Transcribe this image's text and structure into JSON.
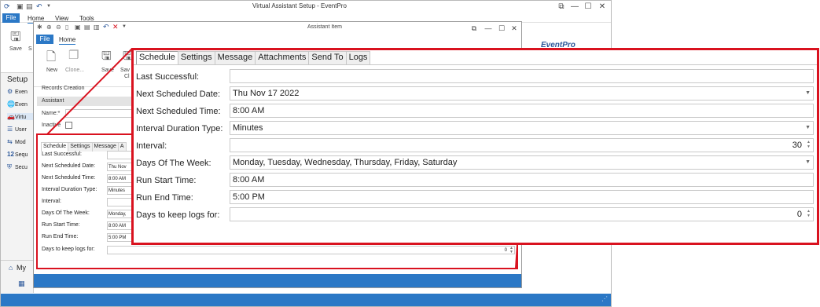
{
  "main_window": {
    "title": "Virtual Assistant Setup - EventPro",
    "menu": {
      "file": "File",
      "home": "Home",
      "view": "View",
      "tools": "Tools"
    },
    "ribbon": {
      "save_label": "Save",
      "save2_label": "S"
    },
    "sidebar": {
      "heading": "Setup",
      "items": [
        {
          "label": "Even",
          "icon": "gear-icon"
        },
        {
          "label": "Even",
          "icon": "globe-icon"
        },
        {
          "label": "Virtu",
          "icon": "car-icon"
        },
        {
          "label": "User",
          "icon": "user-icon"
        },
        {
          "label": "Mod",
          "icon": "module-icon"
        },
        {
          "label": "Sequ",
          "icon": "sequence-number-icon"
        },
        {
          "label": "Secu",
          "icon": "security-icon"
        }
      ],
      "bottom_label": "My",
      "bottom_number_icon_text": "12"
    },
    "window_controls": {
      "restore": "⧉",
      "minimize": "—",
      "maximize": "☐",
      "close": "✕"
    }
  },
  "inner_window": {
    "title": "Assistant Item",
    "menu": {
      "file": "File",
      "home": "Home"
    },
    "ribbon": {
      "new": "New",
      "clone": "Clone...",
      "save": "Save",
      "save_close": "Sav",
      "save_close2": "Cl"
    },
    "section": "Records Creation",
    "group": "Assistant",
    "name_label": "Name:*",
    "inactive_label": "Inactive",
    "mini_tabs": [
      "Schedule",
      "Settings",
      "Message",
      "A"
    ],
    "mini_rows": [
      {
        "label": "Last Successful:",
        "value": ""
      },
      {
        "label": "Next Scheduled Date:",
        "value": "Thu Nov"
      },
      {
        "label": "Next Scheduled Time:",
        "value": "8:00 AM"
      },
      {
        "label": "Interval Duration Type:",
        "value": "Minutes"
      },
      {
        "label": "Interval:",
        "value": ""
      },
      {
        "label": "Days Of The Week:",
        "value": "Monday,"
      },
      {
        "label": "Run Start Time:",
        "value": "8:00 AM"
      },
      {
        "label": "Run End Time:",
        "value": "5:00 PM"
      },
      {
        "label": "Days to keep logs for:",
        "value": "0"
      }
    ],
    "brand": "EventPro"
  },
  "detail_panel": {
    "tabs": [
      "Schedule",
      "Settings",
      "Message",
      "Attachments",
      "Send To",
      "Logs"
    ],
    "active_tab": "Schedule",
    "fields": {
      "last_successful": {
        "label": "Last Successful:",
        "value": ""
      },
      "next_scheduled_date": {
        "label": "Next Scheduled Date:",
        "value": "Thu Nov 17 2022"
      },
      "next_scheduled_time": {
        "label": "Next Scheduled Time:",
        "value": "8:00 AM"
      },
      "interval_duration_type": {
        "label": "Interval Duration Type:",
        "value": "Minutes"
      },
      "interval": {
        "label": "Interval:",
        "value": "30"
      },
      "days_of_week": {
        "label": "Days Of The Week:",
        "value": "Monday, Tuesday, Wednesday, Thursday, Friday, Saturday"
      },
      "run_start_time": {
        "label": "Run Start Time:",
        "value": "8:00 AM"
      },
      "run_end_time": {
        "label": "Run End Time:",
        "value": "5:00 PM"
      },
      "days_to_keep_logs": {
        "label": "Days to keep logs for:",
        "value": "0"
      }
    }
  },
  "colors": {
    "accent": "#2b78c6",
    "highlight_border": "#d9121f"
  }
}
